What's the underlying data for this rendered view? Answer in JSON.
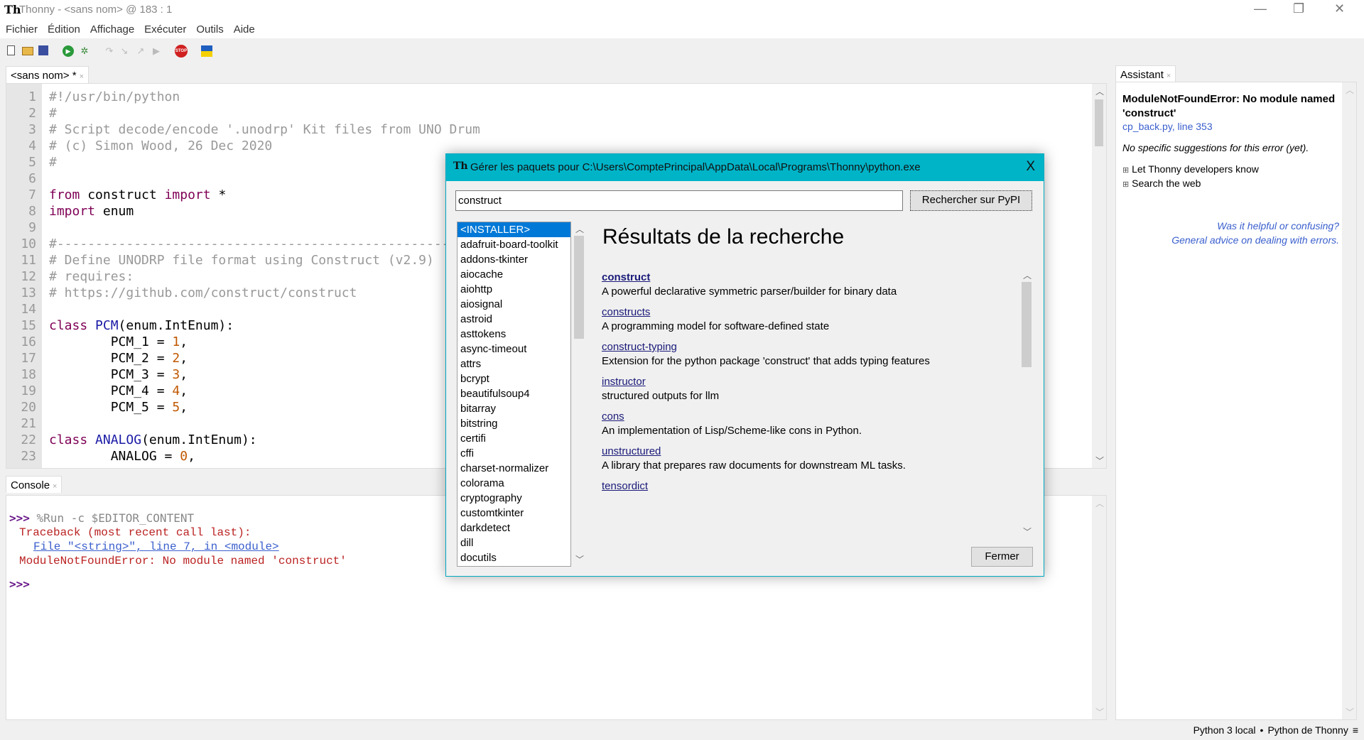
{
  "window": {
    "logo": "Th",
    "title": "Thonny  -  <sans nom>  @  183 : 1",
    "minimize": "—",
    "restore": "❐",
    "close": "✕"
  },
  "menu": [
    "Fichier",
    "Édition",
    "Affichage",
    "Exécuter",
    "Outils",
    "Aide"
  ],
  "toolbar": {
    "icons": [
      "new-file-icon",
      "open-file-icon",
      "save-icon",
      "run-icon",
      "debug-icon",
      "step-over-icon",
      "step-into-icon",
      "step-out-icon",
      "resume-icon",
      "stop-icon",
      "ukraine-flag-icon"
    ],
    "stop_label": "STOP"
  },
  "editor": {
    "tab": "<sans nom> *",
    "close": "×",
    "lines": [
      [
        [
          "#!/usr/bin/python",
          "comment"
        ]
      ],
      [
        [
          "#",
          "comment"
        ]
      ],
      [
        [
          "# Script decode/encode '.unodrp' Kit files from UNO Drum",
          "comment"
        ]
      ],
      [
        [
          "# (c) Simon Wood, 26 Dec 2020",
          "comment"
        ]
      ],
      [
        [
          "#",
          "comment"
        ]
      ],
      [],
      [
        [
          "from",
          "kw"
        ],
        [
          " construct ",
          "name"
        ],
        [
          "import",
          "kw"
        ],
        [
          " *",
          "name"
        ]
      ],
      [
        [
          "import",
          "kw"
        ],
        [
          " enum",
          "name"
        ]
      ],
      [],
      [
        [
          "#------------------------------------------------------------",
          "comment"
        ]
      ],
      [
        [
          "# Define UNODRP file format using Construct (v2.9)",
          "comment"
        ]
      ],
      [
        [
          "# requires:",
          "comment"
        ]
      ],
      [
        [
          "# https://github.com/construct/construct",
          "comment"
        ]
      ],
      [],
      [
        [
          "class",
          "kw"
        ],
        [
          " ",
          "name"
        ],
        [
          "PCM",
          "cls"
        ],
        [
          "(enum.IntEnum):",
          "name"
        ]
      ],
      [
        [
          "        PCM_1 = ",
          "name"
        ],
        [
          "1",
          "num"
        ],
        [
          ",",
          "name"
        ]
      ],
      [
        [
          "        PCM_2 = ",
          "name"
        ],
        [
          "2",
          "num"
        ],
        [
          ",",
          "name"
        ]
      ],
      [
        [
          "        PCM_3 = ",
          "name"
        ],
        [
          "3",
          "num"
        ],
        [
          ",",
          "name"
        ]
      ],
      [
        [
          "        PCM_4 = ",
          "name"
        ],
        [
          "4",
          "num"
        ],
        [
          ",",
          "name"
        ]
      ],
      [
        [
          "        PCM_5 = ",
          "name"
        ],
        [
          "5",
          "num"
        ],
        [
          ",",
          "name"
        ]
      ],
      [],
      [
        [
          "class",
          "kw"
        ],
        [
          " ",
          "name"
        ],
        [
          "ANALOG",
          "cls"
        ],
        [
          "(enum.IntEnum):",
          "name"
        ]
      ],
      [
        [
          "        ANALOG = ",
          "name"
        ],
        [
          "0",
          "num"
        ],
        [
          ",",
          "name"
        ]
      ]
    ]
  },
  "console": {
    "tab": "Console",
    "close": "×",
    "prompt": ">>>",
    "command": " %Run -c $EDITOR_CONTENT",
    "traceback": "Traceback (most recent call last):",
    "file_link": "File \"<string>\", line 7, in <module>",
    "error": "ModuleNotFoundError: No module named 'construct'"
  },
  "assistant": {
    "tab": "Assistant",
    "close": "×",
    "error_title": "ModuleNotFoundError: No module named 'construct'",
    "location_link": "cp_back.py, line 353",
    "no_suggestions": "No specific suggestions for this error (yet).",
    "expanders": [
      "Let Thonny developers know",
      "Search the web"
    ],
    "feedback_link": "Was it helpful or confusing?",
    "advice_link": "General advice on dealing with errors."
  },
  "status": {
    "interpreter": "Python 3 local",
    "separator": "•",
    "python": "Python de Thonny",
    "menu": "≡"
  },
  "dialog": {
    "title": "Gérer les paquets pour C:\\Users\\ComptePrincipal\\AppData\\Local\\Programs\\Thonny\\python.exe",
    "close": "X",
    "search_value": "construct",
    "search_button": "Rechercher sur PyPI",
    "packages": [
      "<INSTALLER>",
      "adafruit-board-toolkit",
      "addons-tkinter",
      "aiocache",
      "aiohttp",
      "aiosignal",
      "astroid",
      "asttokens",
      "async-timeout",
      "attrs",
      "bcrypt",
      "beautifulsoup4",
      "bitarray",
      "bitstring",
      "certifi",
      "cffi",
      "charset-normalizer",
      "colorama",
      "cryptography",
      "customtkinter",
      "darkdetect",
      "dill",
      "docutils"
    ],
    "selected_package": "<INSTALLER>",
    "results_heading": "Résultats de la recherche",
    "results": [
      {
        "name": "construct",
        "desc": "A powerful declarative symmetric parser/builder for binary data"
      },
      {
        "name": "constructs",
        "desc": "A programming model for software-defined state"
      },
      {
        "name": "construct-typing",
        "desc": "Extension for the python package 'construct' that adds typing features"
      },
      {
        "name": "instructor",
        "desc": "structured outputs for llm"
      },
      {
        "name": "cons",
        "desc": "An implementation of Lisp/Scheme-like cons in Python."
      },
      {
        "name": "unstructured",
        "desc": "A library that prepares raw documents for downstream ML tasks."
      },
      {
        "name": "tensordict",
        "desc": ""
      }
    ],
    "close_button": "Fermer"
  }
}
